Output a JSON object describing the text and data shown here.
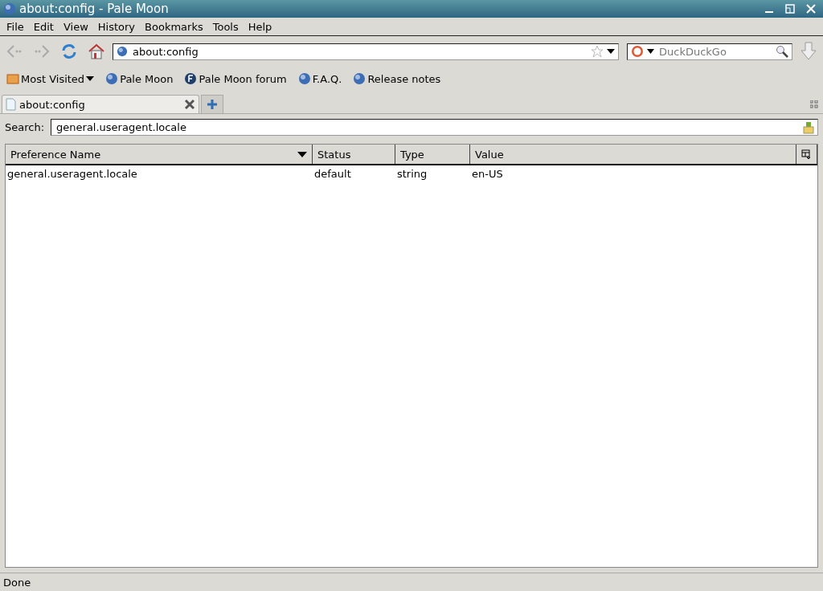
{
  "window": {
    "title": "about:config - Pale Moon"
  },
  "menu": [
    "File",
    "Edit",
    "View",
    "History",
    "Bookmarks",
    "Tools",
    "Help"
  ],
  "address": {
    "value": "about:config"
  },
  "search_engine": {
    "placeholder": "DuckDuckGo"
  },
  "bookmarks": [
    {
      "label": "Most Visited",
      "kind": "folder"
    },
    {
      "label": "Pale Moon",
      "kind": "globe"
    },
    {
      "label": "Pale Moon forum",
      "kind": "forum"
    },
    {
      "label": "F.A.Q.",
      "kind": "globe"
    },
    {
      "label": "Release notes",
      "kind": "globe"
    }
  ],
  "tabs": [
    {
      "label": "about:config",
      "selected": true
    }
  ],
  "filter": {
    "label": "Search:",
    "value": "general.useragent.locale"
  },
  "table": {
    "columns": [
      "Preference Name",
      "Status",
      "Type",
      "Value"
    ],
    "rows": [
      [
        "general.useragent.locale",
        "default",
        "string",
        "en-US"
      ]
    ]
  },
  "status_bar": "Done"
}
